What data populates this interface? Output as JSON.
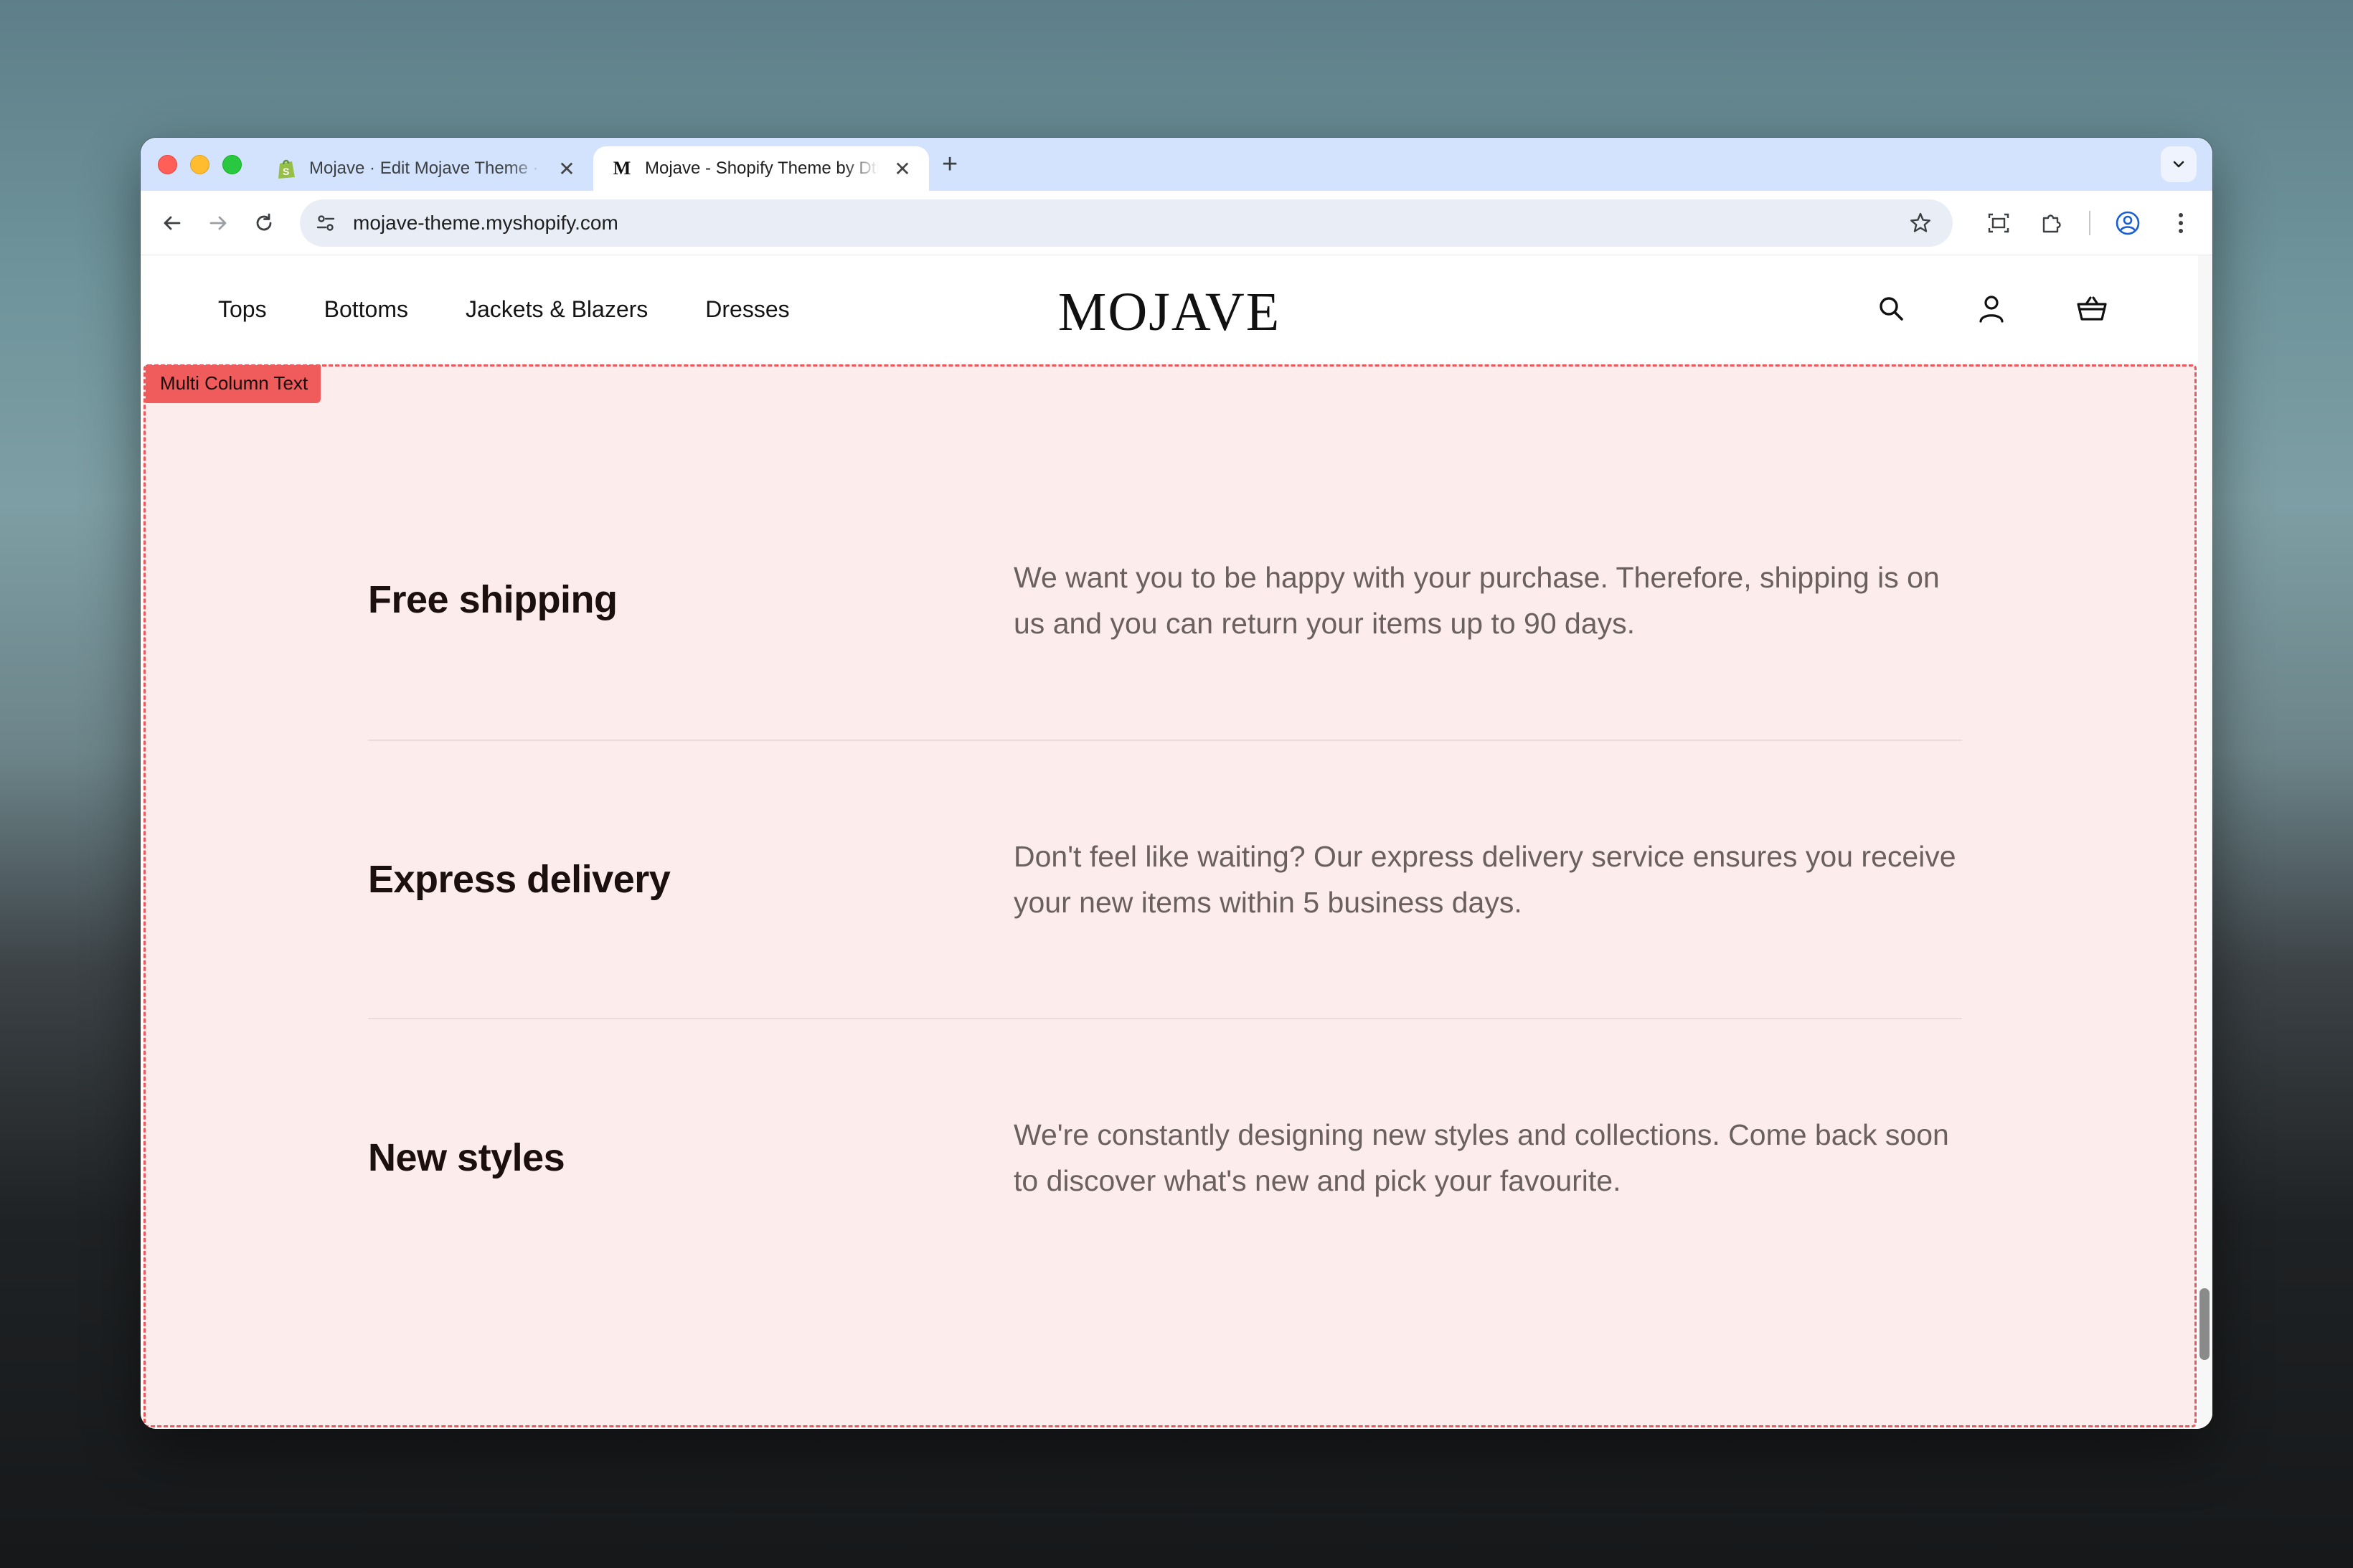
{
  "browser": {
    "tabs": [
      {
        "title": "Mojave · Edit Mojave Theme · Shopify",
        "favicon": "shopify-icon",
        "active": false
      },
      {
        "title": "Mojave - Shopify Theme by Dtheme",
        "favicon": "mojave-m-icon",
        "active": true
      }
    ],
    "address": "mojave-theme.myshopify.com"
  },
  "site": {
    "logo": "MOJAVE",
    "nav": [
      "Tops",
      "Bottoms",
      "Jackets & Blazers",
      "Dresses"
    ],
    "icons": [
      "search-icon",
      "account-icon",
      "cart-icon"
    ]
  },
  "section": {
    "badge": "Multi Column Text",
    "rows": [
      {
        "title": "Free shipping",
        "text": "We want you to be happy with your purchase. Therefore, shipping is on us and you can return your items up to 90 days."
      },
      {
        "title": "Express delivery",
        "text": "Don't feel like waiting? Our express delivery service ensures you receive your new items within 5 business days."
      },
      {
        "title": "New styles",
        "text": "We're constantly designing new styles and collections. Come back soon to discover what's new and pick your favourite."
      }
    ]
  },
  "colors": {
    "section_bg": "#fdecec",
    "badge_bg": "#f05c5c",
    "tabstrip_bg": "#d3e3fd"
  }
}
